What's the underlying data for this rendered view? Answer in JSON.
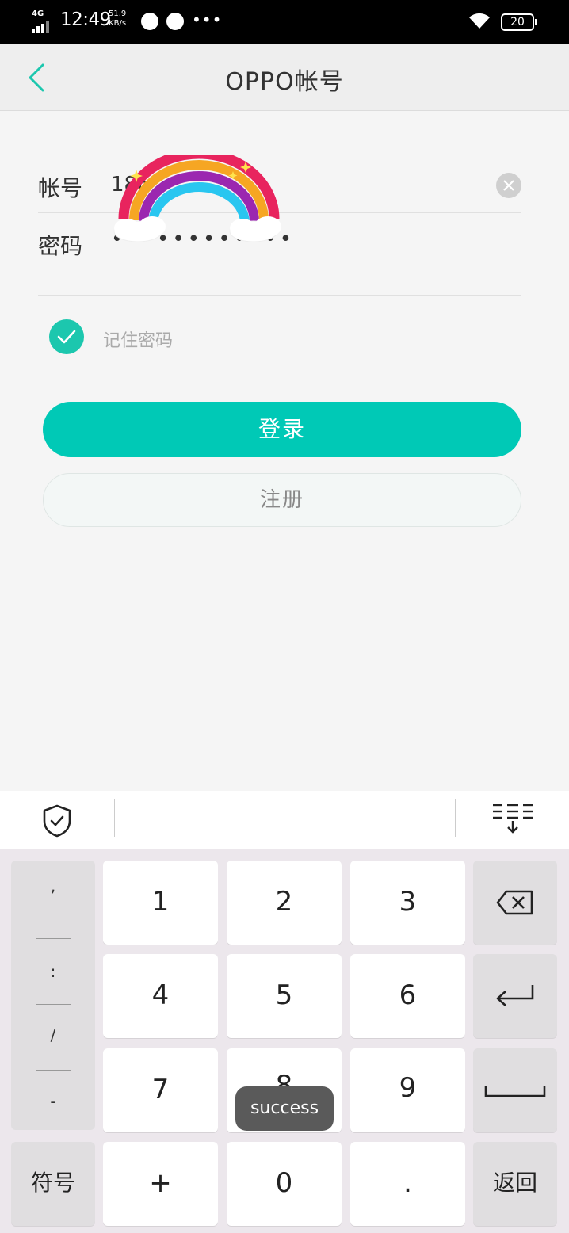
{
  "status_bar": {
    "network": "4G",
    "time": "12:49",
    "speed_value": "51.9",
    "speed_unit": "KB/s",
    "dots": "•••",
    "battery": "20"
  },
  "header": {
    "title": "OPPO帐号"
  },
  "form": {
    "account_label": "帐号",
    "account_value": "186",
    "password_label": "密码",
    "password_value": "••••••••••••",
    "remember_label": "记住密码",
    "remember_checked": true
  },
  "buttons": {
    "login": "登录",
    "register": "注册"
  },
  "keyboard": {
    "symbols": [
      ",",
      ":",
      "/",
      "-"
    ],
    "keys": [
      "1",
      "2",
      "3",
      "4",
      "5",
      "6",
      "7",
      "8",
      "9",
      "+",
      "0",
      "."
    ],
    "symbols_key": "符号",
    "return_key": "返回"
  },
  "toast": "success",
  "colors": {
    "accent": "#00c9b6",
    "check": "#1cc7ae"
  }
}
